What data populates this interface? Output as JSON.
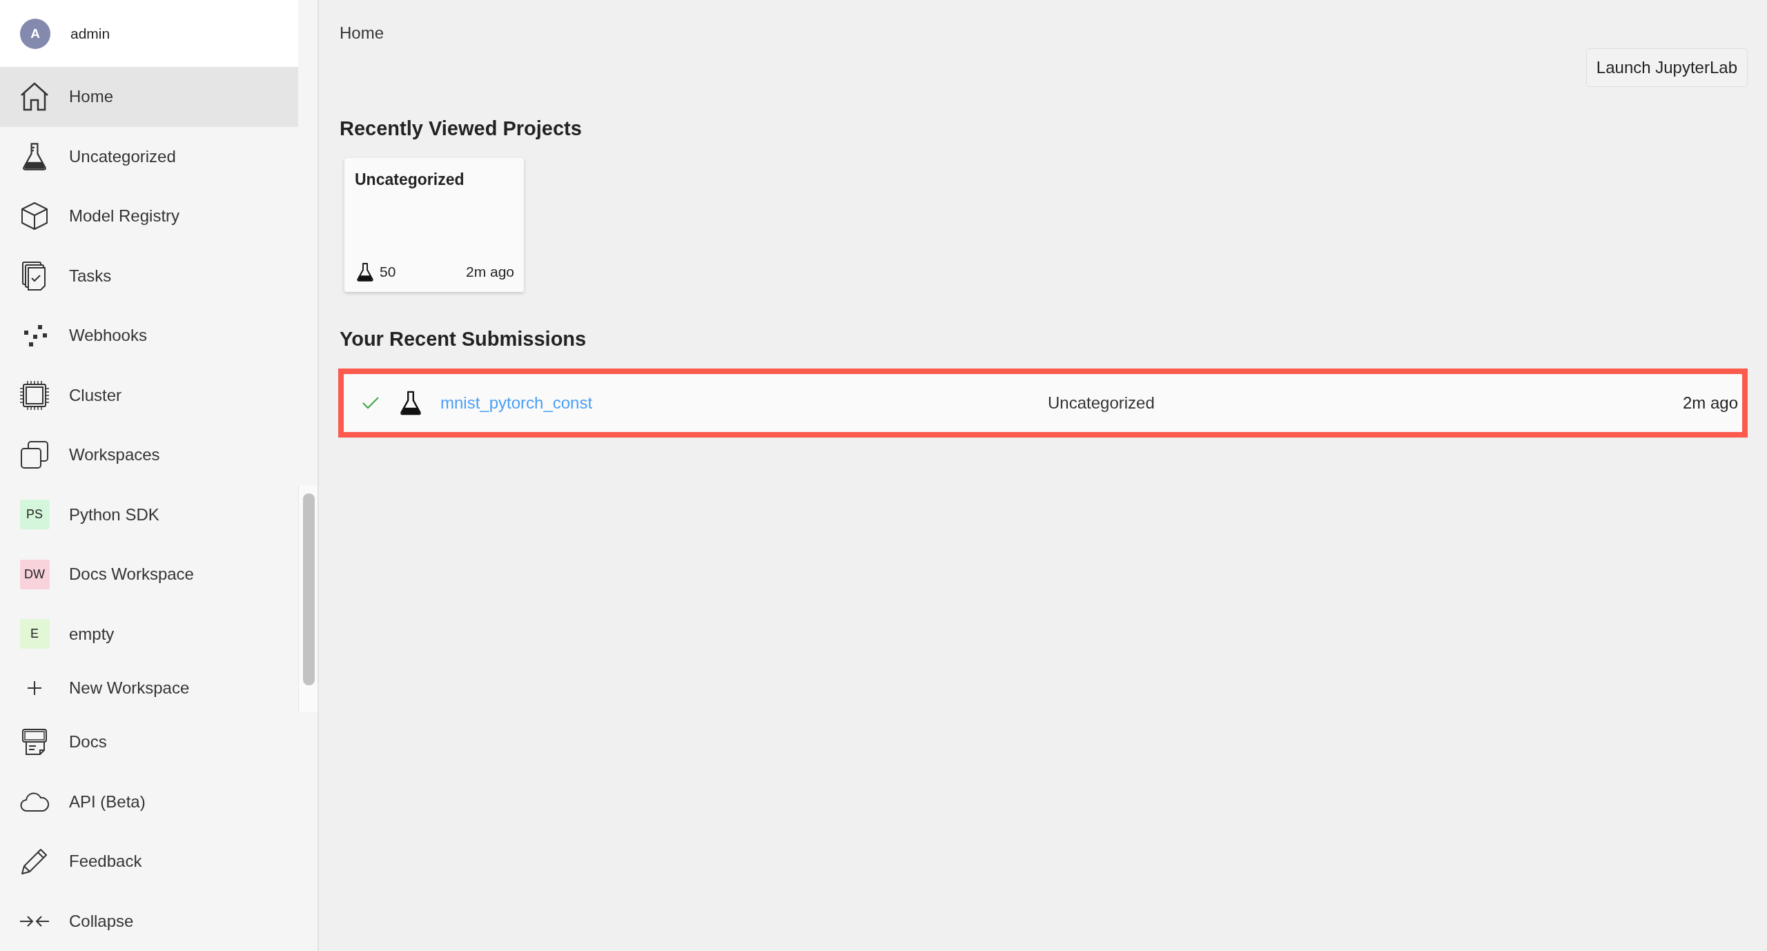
{
  "user": {
    "initial": "A",
    "name": "admin"
  },
  "nav_items": [
    {
      "label": "Home",
      "selected": true
    },
    {
      "label": "Uncategorized",
      "selected": false
    },
    {
      "label": "Model Registry",
      "selected": false
    },
    {
      "label": "Tasks",
      "selected": false
    },
    {
      "label": "Webhooks",
      "selected": false
    },
    {
      "label": "Cluster",
      "selected": false
    },
    {
      "label": "Workspaces",
      "selected": false
    }
  ],
  "workspaces": [
    {
      "initials": "PS",
      "name": "Python SDK",
      "color": "#d4f7dc"
    },
    {
      "initials": "DW",
      "name": "Docs Workspace",
      "color": "#f8d3dc"
    },
    {
      "initials": "E",
      "name": "empty",
      "color": "#e2f7d5"
    }
  ],
  "new_workspace": {
    "label": "New Workspace"
  },
  "footer_items": [
    {
      "label": "Docs"
    },
    {
      "label": "API (Beta)"
    },
    {
      "label": "Feedback"
    },
    {
      "label": "Collapse"
    }
  ],
  "breadcrumb": "Home",
  "launch_button": "Launch JupyterLab",
  "recent_projects": {
    "title": "Recently Viewed Projects",
    "cards": [
      {
        "name": "Uncategorized",
        "count": "50",
        "time": "2m ago"
      }
    ]
  },
  "recent_submissions": {
    "title": "Your Recent Submissions",
    "rows": [
      {
        "completed": true,
        "name": "mnist_pytorch_const",
        "project": "Uncategorized",
        "time": "2m ago",
        "highlighted": true
      }
    ]
  }
}
